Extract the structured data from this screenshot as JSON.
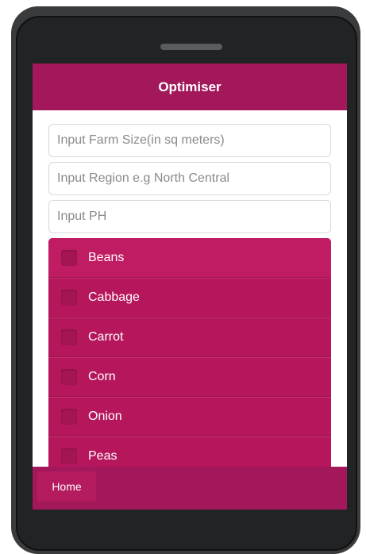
{
  "header": {
    "title": "Optimiser"
  },
  "form": {
    "farm_size_placeholder": "Input Farm Size(in sq meters)",
    "region_placeholder": "Input Region e.g North Central",
    "ph_placeholder": "Input PH"
  },
  "crops": [
    {
      "label": "Beans",
      "checked": false
    },
    {
      "label": "Cabbage",
      "checked": false
    },
    {
      "label": "Carrot",
      "checked": false
    },
    {
      "label": "Corn",
      "checked": false
    },
    {
      "label": "Onion",
      "checked": false
    },
    {
      "label": "Peas",
      "checked": false
    }
  ],
  "footer": {
    "home_label": "Home"
  },
  "colors": {
    "accent": "#a3185a",
    "list_background": "#b6175c",
    "phone_frame": "#3a3b3c"
  }
}
